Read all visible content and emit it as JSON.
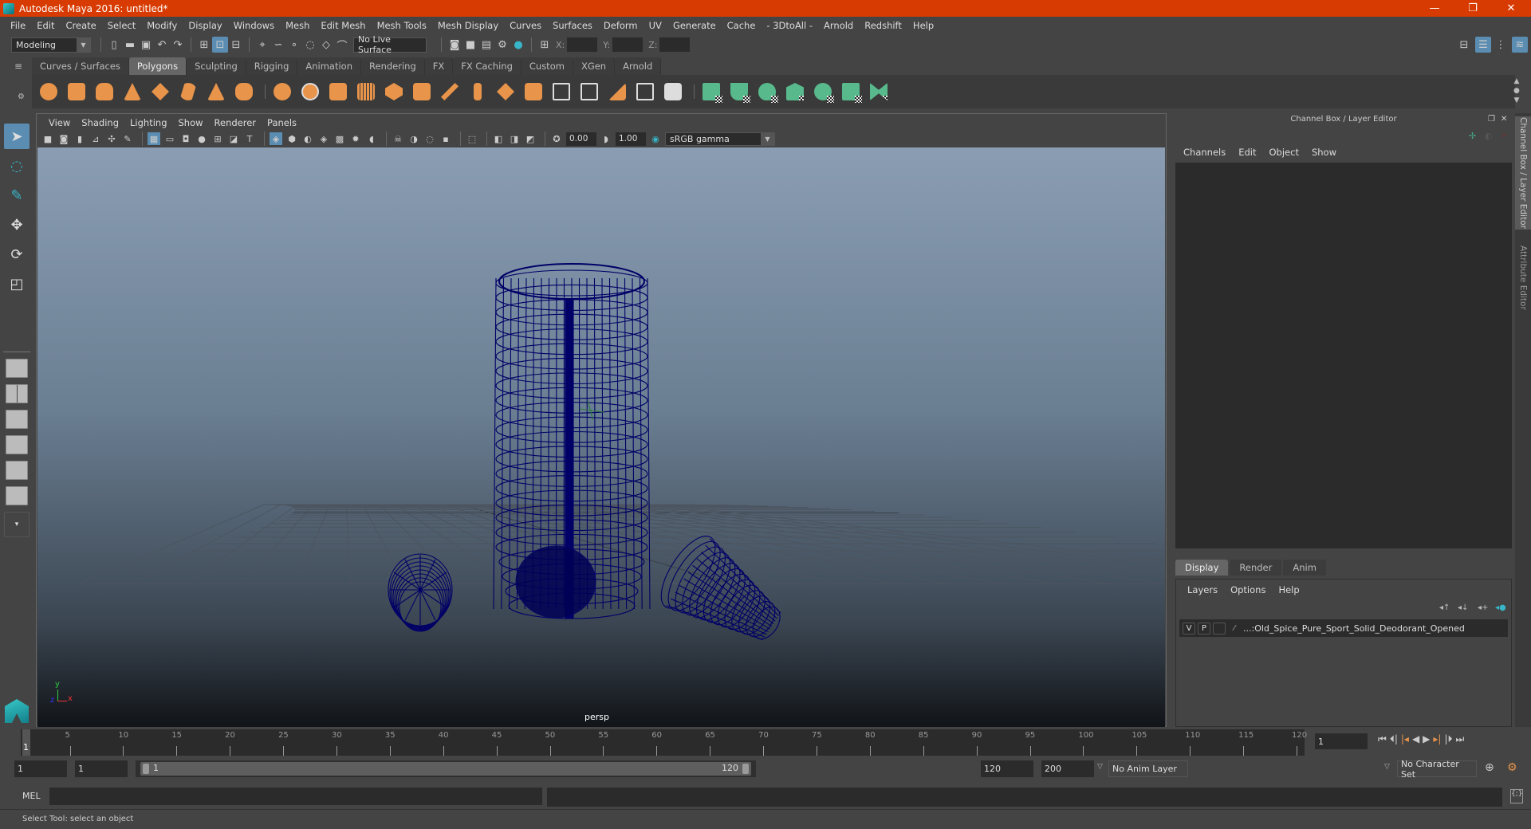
{
  "window": {
    "title": "Autodesk Maya 2016: untitled*",
    "controls": {
      "minimize": "—",
      "restore": "❐",
      "close": "✕"
    }
  },
  "menubar": [
    "File",
    "Edit",
    "Create",
    "Select",
    "Modify",
    "Display",
    "Windows",
    "Mesh",
    "Edit Mesh",
    "Mesh Tools",
    "Mesh Display",
    "Curves",
    "Surfaces",
    "Deform",
    "UV",
    "Generate",
    "Cache",
    "- 3DtoAll -",
    "Arnold",
    "Redshift",
    "Help"
  ],
  "statusline": {
    "menu_set": "Modeling",
    "live_surface": "No Live Surface",
    "x_label": "X:",
    "y_label": "Y:",
    "z_label": "Z:",
    "x_value": "",
    "y_value": "",
    "z_value": ""
  },
  "shelf": {
    "tabs": [
      "Curves / Surfaces",
      "Polygons",
      "Sculpting",
      "Rigging",
      "Animation",
      "Rendering",
      "FX",
      "FX Caching",
      "Custom",
      "XGen",
      "Arnold"
    ],
    "active_tab": "Polygons",
    "primitive_icons": [
      "poly-sphere",
      "poly-cube",
      "poly-cylinder",
      "poly-cone",
      "poly-plane",
      "poly-torus",
      "poly-pyramid",
      "poly-pipe"
    ],
    "modeling_icons": [
      "combine",
      "separate",
      "extract",
      "smooth",
      "boolean",
      "mirror",
      "bevel",
      "bridge",
      "extrude",
      "insert-edge-loop",
      "multi-cut",
      "target-weld",
      "quad-draw",
      "fill-hole",
      "append-polygon",
      "offset-edge-loop"
    ],
    "uv_icons": [
      "planar-map",
      "cylindrical-map",
      "spherical-map",
      "automatic-map",
      "unfold",
      "uv-editor",
      "layout-uv"
    ]
  },
  "toolbox": {
    "tools": [
      "select-tool",
      "lasso-tool",
      "paint-select-tool",
      "move-tool",
      "rotate-tool",
      "scale-tool"
    ],
    "layouts": [
      "single-perspective",
      "four-view",
      "persp-outliner",
      "persp-graph",
      "hypershade-layout",
      "persp-node-editor"
    ]
  },
  "viewport": {
    "menu": [
      "View",
      "Shading",
      "Lighting",
      "Show",
      "Renderer",
      "Panels"
    ],
    "exposure": "0.00",
    "gamma": "1.00",
    "color_space": "sRGB gamma",
    "camera_label": "persp",
    "axis": {
      "x": "x",
      "y": "y",
      "z": "z"
    }
  },
  "channel_box": {
    "title": "Channel Box / Layer Editor",
    "menu": [
      "Channels",
      "Edit",
      "Object",
      "Show"
    ]
  },
  "layer_editor": {
    "tabs": [
      "Display",
      "Render",
      "Anim"
    ],
    "active_tab": "Display",
    "menu": [
      "Layers",
      "Options",
      "Help"
    ],
    "layers": [
      {
        "visible": "V",
        "playback": "P",
        "name": "...:Old_Spice_Pure_Sport_Solid_Deodorant_Opened"
      }
    ]
  },
  "side_tabs": [
    "Channel Box / Layer Editor",
    "Attribute Editor"
  ],
  "timeline": {
    "ticks": [
      5,
      10,
      15,
      20,
      25,
      30,
      35,
      40,
      45,
      50,
      55,
      60,
      65,
      70,
      75,
      80,
      85,
      90,
      95,
      100,
      105,
      110,
      115,
      120
    ],
    "start": 1,
    "end": 120,
    "current_frame_marker": "1",
    "current_frame": "1"
  },
  "range": {
    "start_time": "1",
    "playback_start": "1",
    "slider_start": "1",
    "slider_end": "120",
    "playback_end": "120",
    "end_time": "200",
    "anim_layer": "No Anim Layer",
    "character_set": "No Character Set"
  },
  "playback": [
    "go-to-start",
    "step-back-key",
    "step-back-frame",
    "play-backward",
    "play-forward",
    "step-forward-frame",
    "step-forward-key",
    "go-to-end"
  ],
  "command_line": {
    "label": "MEL",
    "value": "",
    "result": ""
  },
  "help_line": "Select Tool: select an object",
  "colors": {
    "title_bar": "#d83b01",
    "selection": "#5b8db2",
    "wireframe": "#000066",
    "poly_icon": "#e8944a",
    "uv_icon": "#58b98c"
  }
}
